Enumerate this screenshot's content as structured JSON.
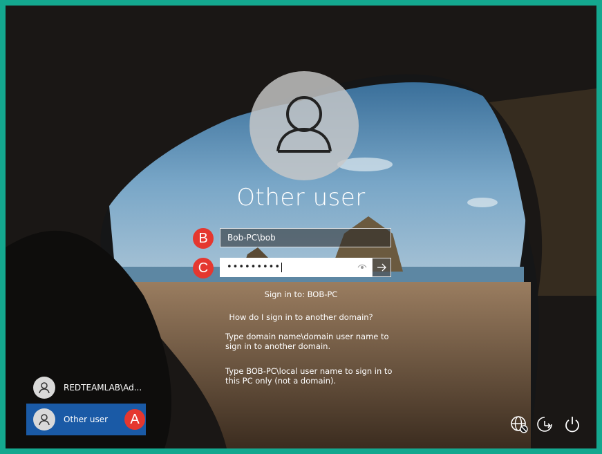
{
  "window": {
    "frame_color": "#14a88f"
  },
  "login": {
    "title": "Other user",
    "username_value": "Bob-PC\\bob",
    "password_value": "•••••••••",
    "sign_in_to": "Sign in to: BOB-PC",
    "domain_help_link": "How do I sign in to another domain?",
    "help_text_1": "Type domain name\\domain user name to sign in to another domain.",
    "help_text_2": "Type BOB-PC\\local user name to sign in to this PC only (not a domain)."
  },
  "markers": {
    "a": "A",
    "b": "B",
    "c": "C",
    "color": "#e5372f"
  },
  "users": [
    {
      "name": "REDTEAMLAB\\Ad..."
    },
    {
      "name": "Other user"
    }
  ],
  "selected_color": "#1a5aa6",
  "icons": [
    "user-avatar-icon",
    "eye-icon",
    "arrow-right-icon",
    "network-icon",
    "ease-of-access-icon",
    "power-icon"
  ]
}
